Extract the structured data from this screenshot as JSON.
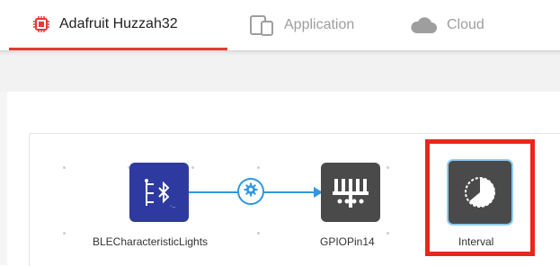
{
  "tabs": [
    {
      "label": "Adafruit Huzzah32",
      "icon": "chip-icon",
      "active": true
    },
    {
      "label": "Application",
      "icon": "devices-icon",
      "active": false
    },
    {
      "label": "Cloud",
      "icon": "cloud-icon",
      "active": false
    }
  ],
  "nodes": [
    {
      "label": "BLECharacteristicLights",
      "icon": "ble-characteristic-icon"
    },
    {
      "label": "GPIOPin14",
      "icon": "gpio-pin-icon"
    },
    {
      "label": "Interval",
      "icon": "interval-timer-icon"
    }
  ],
  "connector": {
    "icon": "gear-icon"
  },
  "colors": {
    "accent": "#e53935",
    "highlight": "#e8271c",
    "wire": "#2f97e0",
    "ble_node": "#2e3a9f",
    "dark_node": "#4a4a4a"
  }
}
